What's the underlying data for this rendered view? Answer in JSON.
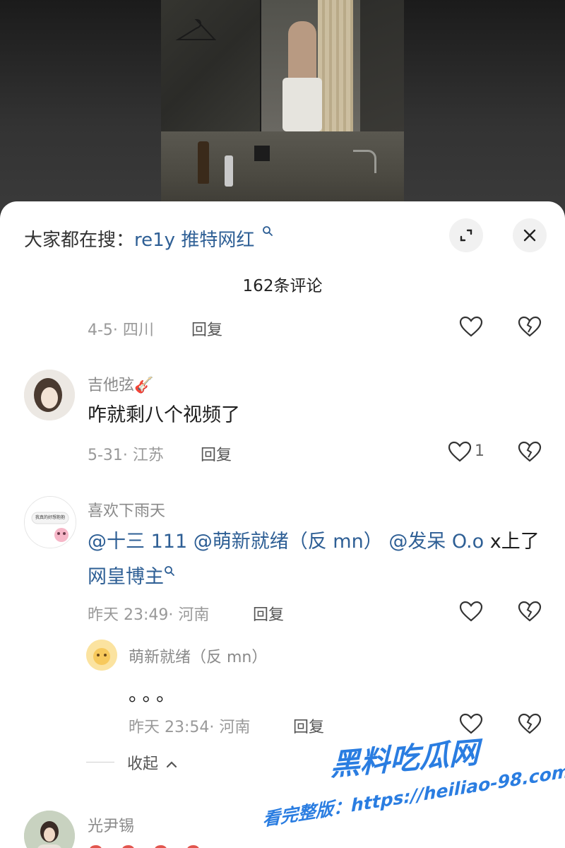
{
  "search": {
    "prefix": "大家都在搜：",
    "query": "re1y 推特网红"
  },
  "comment_count": "162条评论",
  "comments": [
    {
      "meta": "4-5· 四川",
      "reply": "回复"
    },
    {
      "username": "吉他弦",
      "username_emoji": "🎸",
      "text": "咋就剩八个视频了",
      "meta": "5-31· 江苏",
      "reply": "回复",
      "likes": "1"
    },
    {
      "username": "喜欢下雨天",
      "mentions": [
        "@十三 111",
        "@萌新就绪（反 mn）",
        "@发呆 O.o"
      ],
      "text_tail": "x上了",
      "linked_text": "网皇博主",
      "meta": "昨天 23:49· 河南",
      "reply": "回复",
      "avatar_caption": "我真的好想抱抱"
    },
    {
      "username": "萌新就绪（反 mn）",
      "text": "。。。",
      "meta": "昨天 23:54· 河南",
      "reply": "回复"
    },
    {
      "username": "光尹锡"
    }
  ],
  "collapse_label": "收起",
  "watermark": {
    "brand": "黑料吃瓜网",
    "url_line": "看完整版：https://heiliao-98.com"
  },
  "colors": {
    "link": "#2e5f95",
    "watermark": "#2a7de1"
  },
  "icons": [
    "search-icon",
    "expand-icon",
    "close-icon",
    "heart-icon",
    "broken-heart-icon",
    "chevron-up-icon"
  ]
}
